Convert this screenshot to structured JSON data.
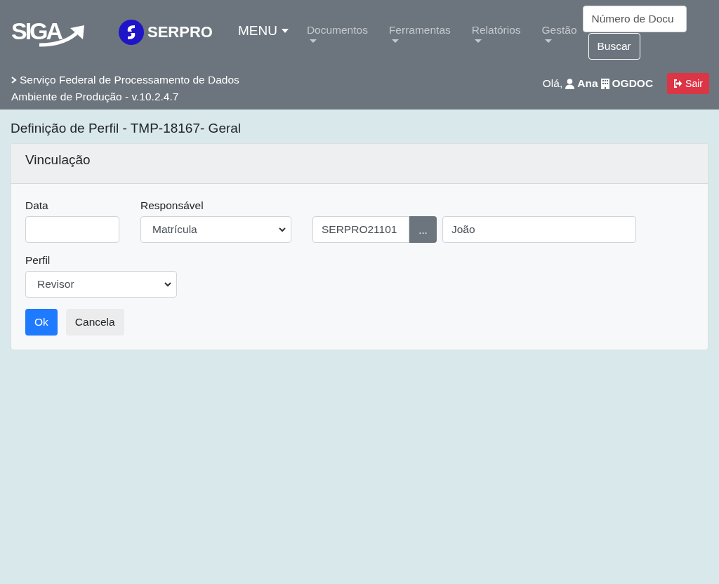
{
  "header": {
    "logo_text": "SIGA",
    "brand_text": "SERPRO",
    "menu": "MENU",
    "nav": [
      {
        "label": "Documentos"
      },
      {
        "label": "Ferramentas"
      },
      {
        "label": "Relatórios"
      },
      {
        "label": "Gestão"
      }
    ],
    "search": {
      "placeholder": "Número de Docu",
      "button": "Buscar"
    },
    "org": "Serviço Federal de Processamento de Dados",
    "env": "Ambiente de Produção - v.10.2.4.7",
    "greeting": "Olá,",
    "user": "Ana",
    "unit": "OGDOC",
    "logout": "Sair"
  },
  "page_title": "Definição de Perfil - TMP-18167- Geral",
  "card": {
    "title": "Vinculação",
    "data": {
      "label": "Data"
    },
    "responsavel": {
      "label": "Responsável",
      "select": "Matrícula",
      "code": "SERPRO21101",
      "picker": "...",
      "name": "João"
    },
    "perfil": {
      "label": "Perfil",
      "select": "Revisor"
    },
    "buttons": [
      {
        "label": "Ok",
        "kind": "primary"
      },
      {
        "label": "Cancela",
        "kind": "secondary"
      }
    ]
  }
}
